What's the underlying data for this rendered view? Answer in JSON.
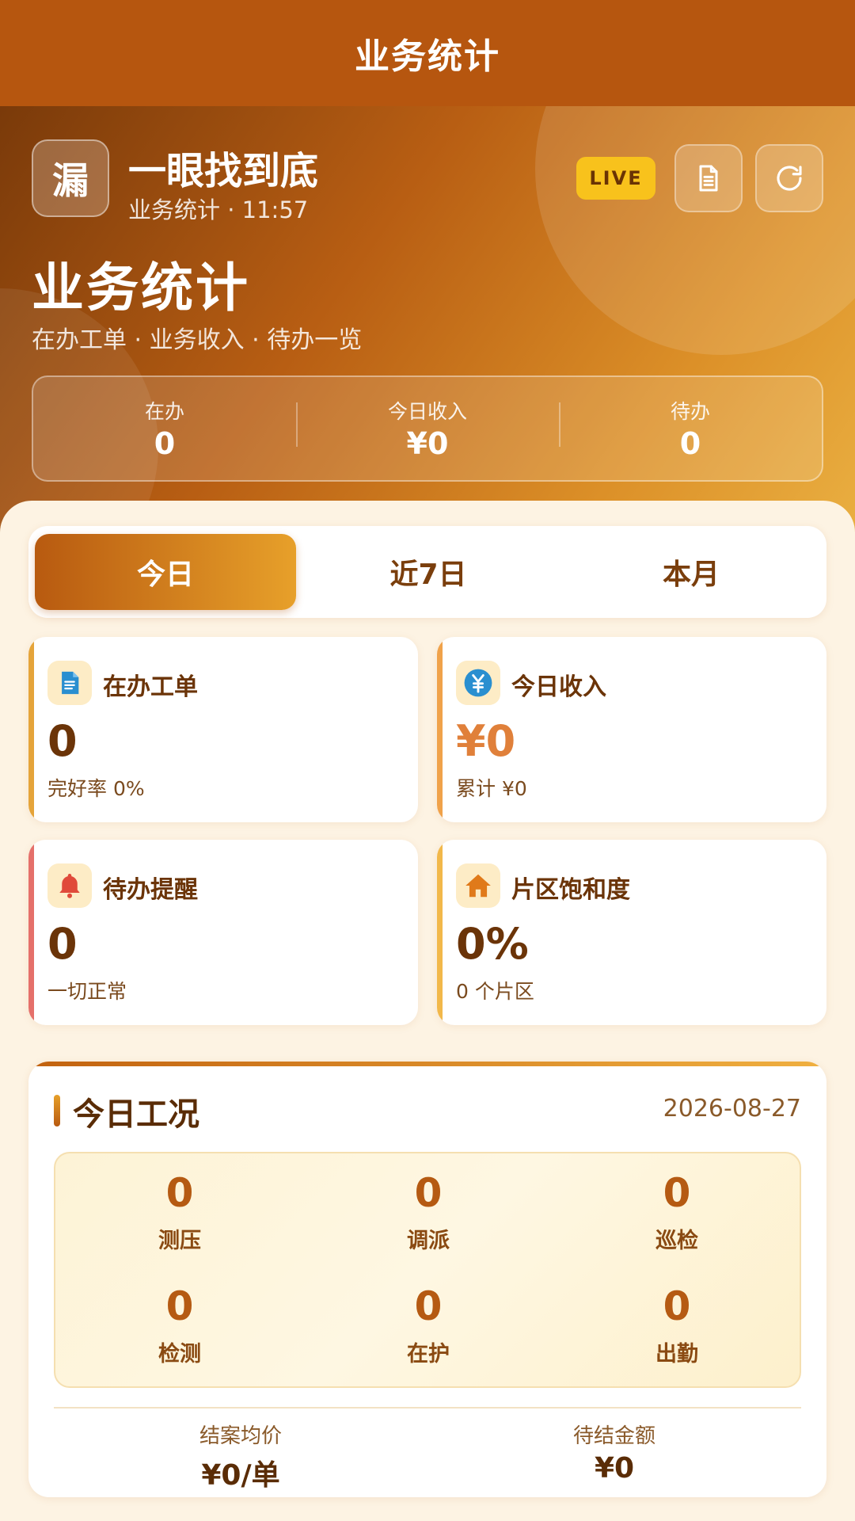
{
  "nav": {
    "title": "业务统计"
  },
  "hero": {
    "logo_char": "漏",
    "app_name": "一眼找到底",
    "subtitle": "业务统计 · 11:57",
    "live_label": "LIVE",
    "doc_icon": "document-icon",
    "refresh_icon": "refresh-icon",
    "title": "业务统计",
    "tagline": "在办工单 · 业务收入 · 待办一览"
  },
  "summary": [
    {
      "label": "在办",
      "value": "0"
    },
    {
      "label": "今日收入",
      "value": "¥0"
    },
    {
      "label": "待办",
      "value": "0"
    }
  ],
  "tabs": [
    {
      "label": "今日",
      "active": true
    },
    {
      "label": "近7日",
      "active": false
    },
    {
      "label": "本月",
      "active": false
    }
  ],
  "cards": [
    {
      "icon": "document-icon",
      "title": "在办工单",
      "value": "0",
      "sub": "完好率 0%",
      "color": "#2a8fd0"
    },
    {
      "icon": "yuan-icon",
      "title": "今日收入",
      "value": "¥0",
      "sub": "累计 ¥0",
      "color": "#2a8fd0"
    },
    {
      "icon": "bell-icon",
      "title": "待办提醒",
      "value": "0",
      "sub": "一切正常",
      "color": "#e04a3a"
    },
    {
      "icon": "home-icon",
      "title": "片区饱和度",
      "value": "0%",
      "sub": "0 个片区",
      "color": "#e07a1a"
    }
  ],
  "work": {
    "title": "今日工况",
    "date": "2026-08-27",
    "items": [
      {
        "label": "测压",
        "value": "0"
      },
      {
        "label": "调派",
        "value": "0"
      },
      {
        "label": "巡检",
        "value": "0"
      },
      {
        "label": "检测",
        "value": "0"
      },
      {
        "label": "在护",
        "value": "0"
      },
      {
        "label": "出勤",
        "value": "0"
      }
    ],
    "footer": [
      {
        "label": "结案均价",
        "value": "¥0/单"
      },
      {
        "label": "待结金额",
        "value": "¥0"
      }
    ]
  }
}
